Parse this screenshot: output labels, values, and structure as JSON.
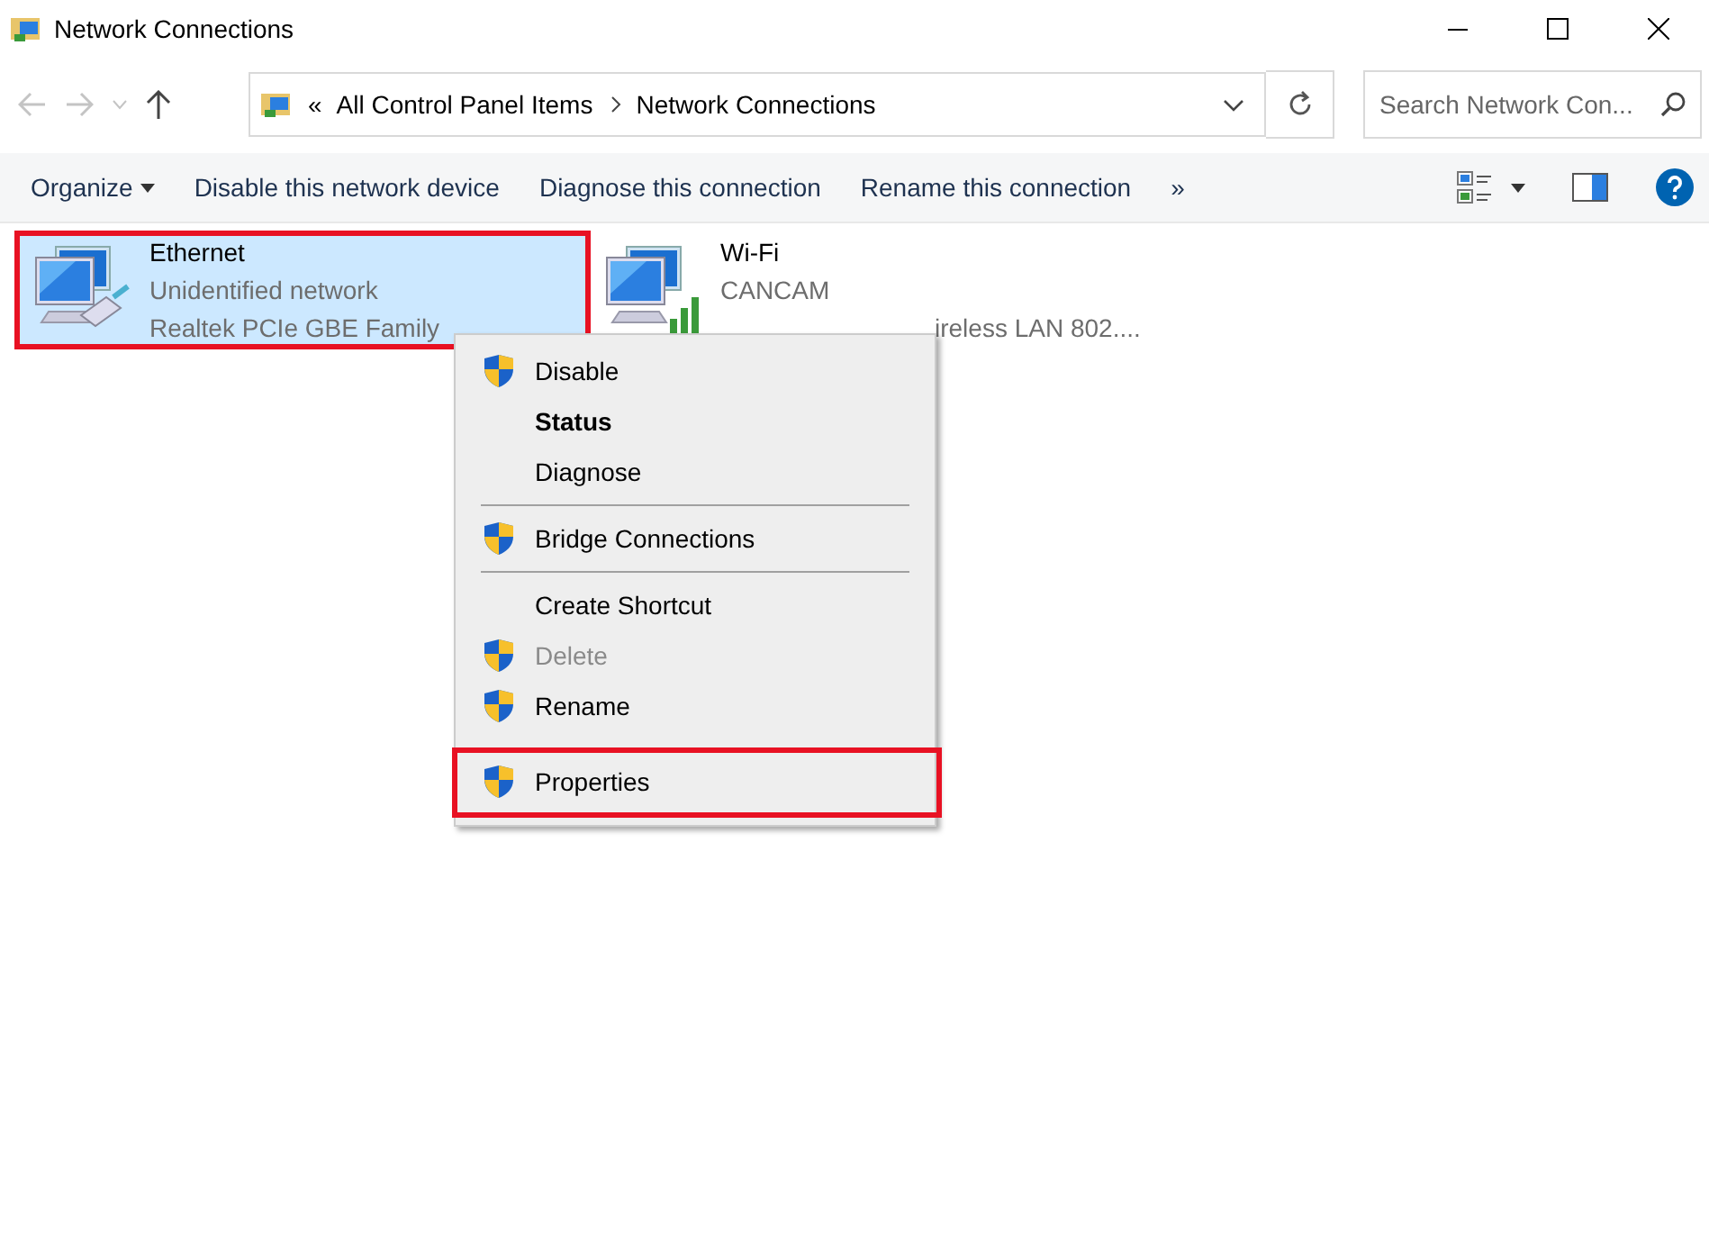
{
  "window": {
    "title": "Network Connections"
  },
  "address": {
    "crumbs": [
      "«",
      "All Control Panel Items",
      "Network Connections"
    ],
    "search_placeholder": "Search Network Con..."
  },
  "toolbar": {
    "items": [
      {
        "label": "Organize",
        "kind": "dropdown"
      },
      {
        "label": "Disable this network device",
        "kind": "plain"
      },
      {
        "label": "Diagnose this connection",
        "kind": "plain"
      },
      {
        "label": "Rename this connection",
        "kind": "plain"
      },
      {
        "label": "»",
        "kind": "plain"
      }
    ]
  },
  "connections": [
    {
      "name": "Ethernet",
      "status": "Unidentified network",
      "device": "Realtek PCIe GBE Family",
      "selected": true,
      "highlighted": true,
      "kind": "wired"
    },
    {
      "name": "Wi-Fi",
      "status": "CANCAM",
      "device": "ireless LAN 802....",
      "selected": false,
      "highlighted": false,
      "kind": "wireless"
    }
  ],
  "context_menu": {
    "items": [
      {
        "label": "Disable",
        "shield": true,
        "bold": false,
        "disabled": false,
        "highlighted": false,
        "separator_after": false
      },
      {
        "label": "Status",
        "shield": false,
        "bold": true,
        "disabled": false,
        "highlighted": false,
        "separator_after": false
      },
      {
        "label": "Diagnose",
        "shield": false,
        "bold": false,
        "disabled": false,
        "highlighted": false,
        "separator_after": true
      },
      {
        "label": "Bridge Connections",
        "shield": true,
        "bold": false,
        "disabled": false,
        "highlighted": false,
        "separator_after": true
      },
      {
        "label": "Create Shortcut",
        "shield": false,
        "bold": false,
        "disabled": false,
        "highlighted": false,
        "separator_after": false
      },
      {
        "label": "Delete",
        "shield": true,
        "bold": false,
        "disabled": true,
        "highlighted": false,
        "separator_after": false
      },
      {
        "label": "Rename",
        "shield": true,
        "bold": false,
        "disabled": false,
        "highlighted": false,
        "separator_after": false
      },
      {
        "label": "Properties",
        "shield": true,
        "bold": false,
        "disabled": false,
        "highlighted": true,
        "separator_after": false
      }
    ]
  }
}
